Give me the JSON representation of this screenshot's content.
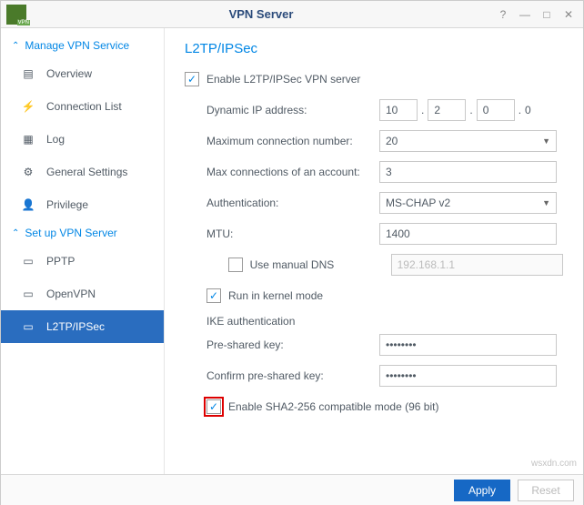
{
  "window": {
    "title": "VPN Server"
  },
  "sidebar": {
    "section1": {
      "label": "Manage VPN Service"
    },
    "items1": [
      {
        "label": "Overview"
      },
      {
        "label": "Connection List"
      },
      {
        "label": "Log"
      },
      {
        "label": "General Settings"
      },
      {
        "label": "Privilege"
      }
    ],
    "section2": {
      "label": "Set up VPN Server"
    },
    "items2": [
      {
        "label": "PPTP"
      },
      {
        "label": "OpenVPN"
      },
      {
        "label": "L2TP/IPSec"
      }
    ]
  },
  "form": {
    "title": "L2TP/IPSec",
    "enable_label": "Enable L2TP/IPSec VPN server",
    "dynamic_ip_label": "Dynamic IP address:",
    "ip1": "10",
    "ip2": "2",
    "ip3": "0",
    "ip4": "0",
    "max_conn_label": "Maximum connection number:",
    "max_conn_value": "20",
    "max_account_label": "Max connections of an account:",
    "max_account_value": "3",
    "auth_label": "Authentication:",
    "auth_value": "MS-CHAP v2",
    "mtu_label": "MTU:",
    "mtu_value": "1400",
    "manual_dns_label": "Use manual DNS",
    "manual_dns_value": "192.168.1.1",
    "kernel_label": "Run in kernel mode",
    "ike_header": "IKE authentication",
    "psk_label": "Pre-shared key:",
    "psk_value": "••••••••",
    "psk_confirm_label": "Confirm pre-shared key:",
    "psk_confirm_value": "••••••••",
    "sha_label": "Enable SHA2-256 compatible mode (96 bit)"
  },
  "footer": {
    "apply": "Apply",
    "reset": "Reset"
  },
  "watermark": "wsxdn.com"
}
